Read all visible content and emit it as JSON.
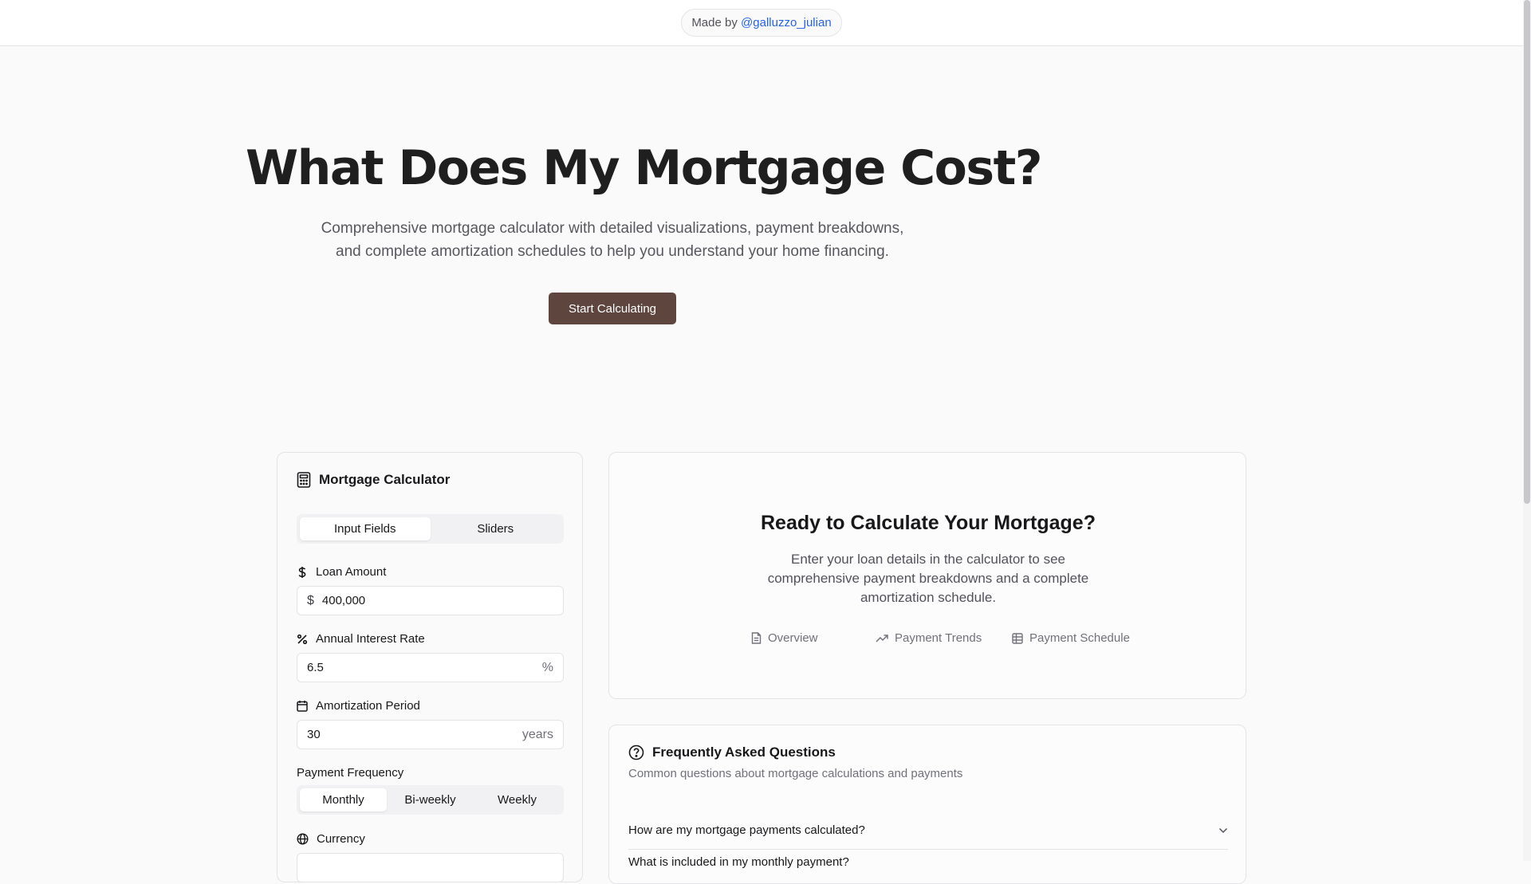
{
  "header": {
    "made_by_prefix": "Made by",
    "made_by_handle": "@galluzzo_julian"
  },
  "hero": {
    "title": "What Does My Mortgage Cost?",
    "subtitle_line1": "Comprehensive mortgage calculator with detailed visualizations, payment breakdowns,",
    "subtitle_line2": "and complete amortization schedules to help you understand your home financing.",
    "cta_label": "Start Calculating"
  },
  "calculator": {
    "title": "Mortgage Calculator",
    "mode_tabs": [
      {
        "label": "Input Fields",
        "active": true
      },
      {
        "label": "Sliders",
        "active": false
      }
    ],
    "loan_amount": {
      "label": "Loan Amount",
      "prefix": "$",
      "value": "400,000"
    },
    "interest_rate": {
      "label": "Annual Interest Rate",
      "value": "6.5",
      "suffix": "%"
    },
    "amortization": {
      "label": "Amortization Period",
      "value": "30",
      "suffix": "years"
    },
    "frequency": {
      "label": "Payment Frequency",
      "options": [
        {
          "label": "Monthly",
          "active": true
        },
        {
          "label": "Bi-weekly",
          "active": false
        },
        {
          "label": "Weekly",
          "active": false
        }
      ]
    },
    "currency": {
      "label": "Currency"
    }
  },
  "ready": {
    "title": "Ready to Calculate Your Mortgage?",
    "desc_line1": "Enter your loan details in the calculator to see",
    "desc_line2": "comprehensive payment breakdowns and a complete",
    "desc_line3": "amortization schedule.",
    "links": [
      {
        "label": "Overview",
        "icon": "file-text-icon"
      },
      {
        "label": "Payment Trends",
        "icon": "trending-up-icon"
      },
      {
        "label": "Payment Schedule",
        "icon": "table-icon"
      }
    ]
  },
  "faq": {
    "title": "Frequently Asked Questions",
    "subtitle": "Common questions about mortgage calculations and payments",
    "items": [
      {
        "question": "How are my mortgage payments calculated?"
      },
      {
        "question": "What is included in my monthly payment?"
      }
    ]
  },
  "colors": {
    "accent_button": "#5e453e",
    "link": "#2563eb",
    "background": "#fafafa"
  }
}
